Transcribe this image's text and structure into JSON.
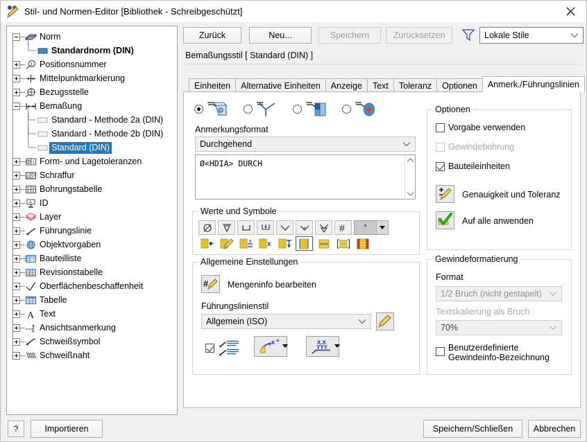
{
  "window": {
    "title": "Stil- und Normen-Editor [Bibliothek - Schreibgeschützt]",
    "close_label": "✕",
    "icon": "pencil-palette-icon"
  },
  "tree": {
    "items": [
      {
        "label": "Norm",
        "icon": "book-icon",
        "toggle": "minus",
        "depth": 0,
        "bold": false,
        "selected": false
      },
      {
        "label": "Standardnorm (DIN)",
        "icon": "blue-rect-icon",
        "toggle": "none",
        "depth": 1,
        "bold": true,
        "selected": false
      },
      {
        "label": "Positionsnummer",
        "icon": "balloon-icon",
        "toggle": "plus",
        "depth": 0,
        "bold": false,
        "selected": false
      },
      {
        "label": "Mittelpunktmarkierung",
        "icon": "centermark-icon",
        "toggle": "plus",
        "depth": 0,
        "bold": false,
        "selected": false
      },
      {
        "label": "Bezugsstelle",
        "icon": "datum-target-icon",
        "toggle": "plus",
        "depth": 0,
        "bold": false,
        "selected": false
      },
      {
        "label": "Bemaßung",
        "icon": "dimension-icon",
        "toggle": "minus",
        "depth": 0,
        "bold": false,
        "selected": false
      },
      {
        "label": "Standard - Methode 2a (DIN)",
        "icon": "grey-rect-icon",
        "toggle": "none",
        "depth": 1,
        "bold": false,
        "selected": false
      },
      {
        "label": "Standard - Methode 2b (DIN)",
        "icon": "grey-rect-icon",
        "toggle": "none",
        "depth": 1,
        "bold": false,
        "selected": false
      },
      {
        "label": "Standard (DIN)",
        "icon": "grey-rect-icon",
        "toggle": "none",
        "depth": 1,
        "bold": false,
        "selected": true
      },
      {
        "label": "Form- und Lagetoleranzen",
        "icon": "gdt-icon",
        "toggle": "plus",
        "depth": 0,
        "bold": false,
        "selected": false
      },
      {
        "label": "Schraffur",
        "icon": "hatch-icon",
        "toggle": "plus",
        "depth": 0,
        "bold": false,
        "selected": false
      },
      {
        "label": "Bohrungstabelle",
        "icon": "holetable-icon",
        "toggle": "plus",
        "depth": 0,
        "bold": false,
        "selected": false
      },
      {
        "label": "ID",
        "icon": "id-icon",
        "toggle": "plus",
        "depth": 0,
        "bold": false,
        "selected": false
      },
      {
        "label": "Layer",
        "icon": "layer-icon",
        "toggle": "plus",
        "depth": 0,
        "bold": false,
        "selected": false
      },
      {
        "label": "Führungslinie",
        "icon": "leader-icon",
        "toggle": "plus",
        "depth": 0,
        "bold": false,
        "selected": false
      },
      {
        "label": "Objektvorgaben",
        "icon": "globe-icon",
        "toggle": "plus",
        "depth": 0,
        "bold": false,
        "selected": false
      },
      {
        "label": "Bauteilliste",
        "icon": "partslist-icon",
        "toggle": "plus",
        "depth": 0,
        "bold": false,
        "selected": false
      },
      {
        "label": "Revisionstabelle",
        "icon": "revtable-icon",
        "toggle": "plus",
        "depth": 0,
        "bold": false,
        "selected": false
      },
      {
        "label": "Oberflächenbeschaffenheit",
        "icon": "surface-finish-icon",
        "toggle": "plus",
        "depth": 0,
        "bold": false,
        "selected": false
      },
      {
        "label": "Tabelle",
        "icon": "table-icon",
        "toggle": "plus",
        "depth": 0,
        "bold": false,
        "selected": false
      },
      {
        "label": "Text",
        "icon": "text-a-icon",
        "toggle": "plus",
        "depth": 0,
        "bold": false,
        "selected": false
      },
      {
        "label": "Ansichtsanmerkung",
        "icon": "view-annotation-icon",
        "toggle": "plus",
        "depth": 0,
        "bold": false,
        "selected": false
      },
      {
        "label": "Schweißsymbol",
        "icon": "weld-symbol-icon",
        "toggle": "plus",
        "depth": 0,
        "bold": false,
        "selected": false
      },
      {
        "label": "Schweißnaht",
        "icon": "weld-bead-icon",
        "toggle": "plus",
        "depth": 0,
        "bold": false,
        "selected": false
      }
    ]
  },
  "toolbar": {
    "back_label": "Zurück",
    "new_label": "Neu...",
    "save_label": "Speichern",
    "reset_label": "Zurücksetzen",
    "filter_icon": "funnel-icon",
    "filter_value": "Lokale Stile"
  },
  "content": {
    "style_header": "Bemaßungsstil [ Standard (DIN) ]",
    "tabs": [
      {
        "label": "Einheiten",
        "active": false
      },
      {
        "label": "Alternative Einheiten",
        "active": false
      },
      {
        "label": "Anzeige",
        "active": false
      },
      {
        "label": "Text",
        "active": false
      },
      {
        "label": "Toleranz",
        "active": false
      },
      {
        "label": "Optionen",
        "active": false
      },
      {
        "label": "Anmerk./Führungslinien",
        "active": true
      }
    ],
    "mode_radios": [
      {
        "icon": "hole-note-icon",
        "selected": true
      },
      {
        "icon": "chamfer-note-icon",
        "selected": false
      },
      {
        "icon": "punch-note-icon",
        "selected": false
      },
      {
        "icon": "bend-note-icon",
        "selected": false
      }
    ],
    "annotation_format_label": "Anmerkungsformat",
    "annotation_format_value": "Durchgehend",
    "annotation_text": "Ø<HDIA> DURCH",
    "values_group_label": "Werte und Symbole",
    "values_row1": [
      {
        "icon": "diameter-symbol-icon"
      },
      {
        "icon": "depth-symbol-icon"
      },
      {
        "icon": "counterbore-symbol-icon"
      },
      {
        "icon": "spotface-symbol-icon"
      },
      {
        "icon": "countersink-symbol-icon"
      },
      {
        "icon": "countersink-angle-symbol-icon"
      },
      {
        "icon": "deep-symbol-icon"
      },
      {
        "icon": "number-hash-symbol-icon"
      }
    ],
    "degree_dropdown_value": "°",
    "values_row2": [
      {
        "icon": "insert-value-icon"
      },
      {
        "icon": "edit-value-icon"
      },
      {
        "icon": "tolerance-value-icon"
      },
      {
        "icon": "multiply-value-icon"
      },
      {
        "icon": "depth-value-icon"
      },
      {
        "icon": "thread-value-icon"
      },
      {
        "icon": "stack-value-icon"
      },
      {
        "icon": "bracket-value-icon"
      },
      {
        "icon": "inspect-value-icon"
      }
    ],
    "general_group_label": "Allgemeine Einstellungen",
    "quantity_button_label": "Mengeninfo bearbeiten",
    "quantity_button_icon": "hash-pencil-icon",
    "leader_style_label": "Führungslinienstil",
    "leader_style_value": "Allgemein (ISO)",
    "leader_edit_icon": "pencil-icon",
    "multi_leader_checkbox": true,
    "multi_leader_icon": "multi-leader-icon",
    "arrow_button_icon": "leader-arrow-icon",
    "text_button_icon": "leader-text-icon"
  },
  "options": {
    "group_label": "Optionen",
    "items": [
      {
        "label": "Vorgabe verwenden",
        "checked": false,
        "disabled": false
      },
      {
        "label": "Gewindebohrung",
        "checked": false,
        "disabled": true
      },
      {
        "label": "Bauteileinheiten",
        "checked": true,
        "disabled": false
      }
    ],
    "precision_label": "Genauigkeit und Toleranz",
    "precision_icon": "precision-pencil-icon",
    "apply_all_label": "Auf alle anwenden",
    "apply_all_icon": "green-check-icon"
  },
  "thread": {
    "group_label": "Gewindeformatierung",
    "format_label": "Format",
    "format_value": "1/2 Bruch (nicht gestapelt)",
    "scale_label": "Textskalierung als Bruch",
    "scale_value": "70%",
    "custom_label_line1": "Benutzerdefinierte",
    "custom_label_line2": "Gewindeinfo-Bezeichnung",
    "custom_checked": false
  },
  "footer": {
    "help_label": "?",
    "import_label": "Importieren",
    "save_close_label": "Speichern/Schließen",
    "cancel_label": "Abbrechen"
  },
  "colors": {
    "accent": "#1a7bc4",
    "panel_bg": "#f0f0f0",
    "white": "#ffffff",
    "icon_blue": "#1f5fa8",
    "icon_yellow": "#f4d23c",
    "green": "#22aa22"
  }
}
